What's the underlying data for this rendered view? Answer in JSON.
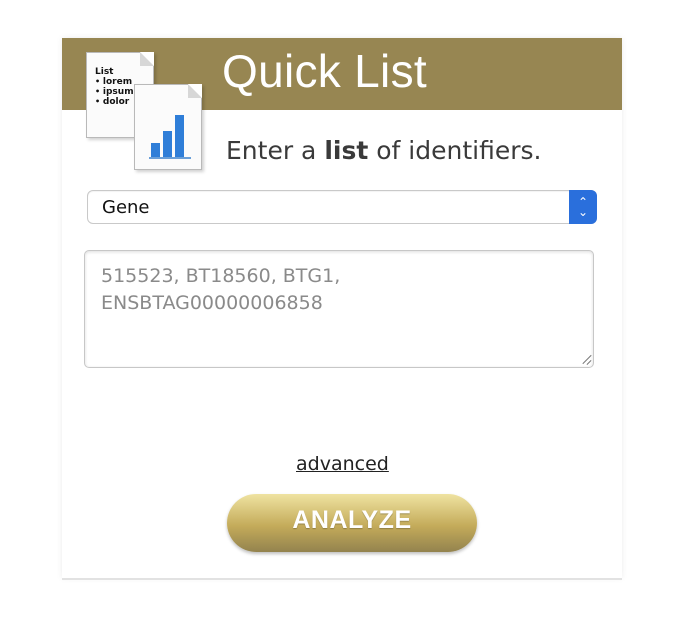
{
  "header": {
    "title": "Quick List"
  },
  "icon_docs": {
    "list_doc": {
      "heading": "List",
      "items": [
        "lorem",
        "ipsum",
        "dolor"
      ]
    }
  },
  "form": {
    "prompt_prefix": "Enter a ",
    "prompt_bold": "list",
    "prompt_suffix": " of identifiers.",
    "select": {
      "value": "Gene"
    },
    "textarea": {
      "placeholder": "515523, BT18560, BTG1,\nENSBTAG00000006858",
      "value": ""
    },
    "advanced_label": "advanced",
    "analyze_label": "ANALYZE"
  },
  "colors": {
    "header_bg": "#978652",
    "select_arrow": "#2a6fdc",
    "chart_bar": "#2f7ed8"
  }
}
